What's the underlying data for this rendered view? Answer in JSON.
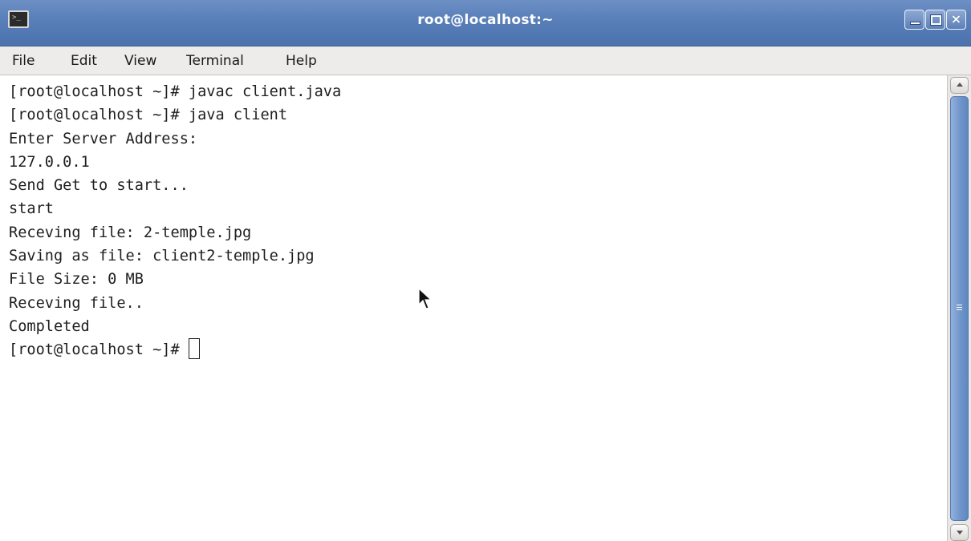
{
  "window": {
    "title": "root@localhost:~",
    "icon": "terminal-app-icon",
    "controls": {
      "minimize_icon": "minimize-icon",
      "maximize_icon": "maximize-icon",
      "close_icon": "close-icon",
      "close_glyph": "×"
    }
  },
  "menu": {
    "file": "File",
    "edit": "Edit",
    "view": "View",
    "terminal": "Terminal",
    "help": "Help"
  },
  "terminal": {
    "lines": [
      "[root@localhost ~]# javac client.java",
      "[root@localhost ~]# java client",
      "Enter Server Address:",
      "127.0.0.1",
      "Send Get to start...",
      "start",
      "Receving file: 2-temple.jpg",
      "Saving as file: client2-temple.jpg",
      "File Size: 0 MB",
      "Receving file..",
      "Completed"
    ],
    "prompt": "[root@localhost ~]# "
  },
  "scrollbar": {
    "position": 0.0,
    "visible_fraction": 1.0
  },
  "colors": {
    "titlebar": "#5a80ba",
    "menubar": "#edeceb",
    "terminal_bg": "#ffffff",
    "terminal_fg": "#1e1e1e",
    "scroll_thumb": "#6d93c9"
  }
}
